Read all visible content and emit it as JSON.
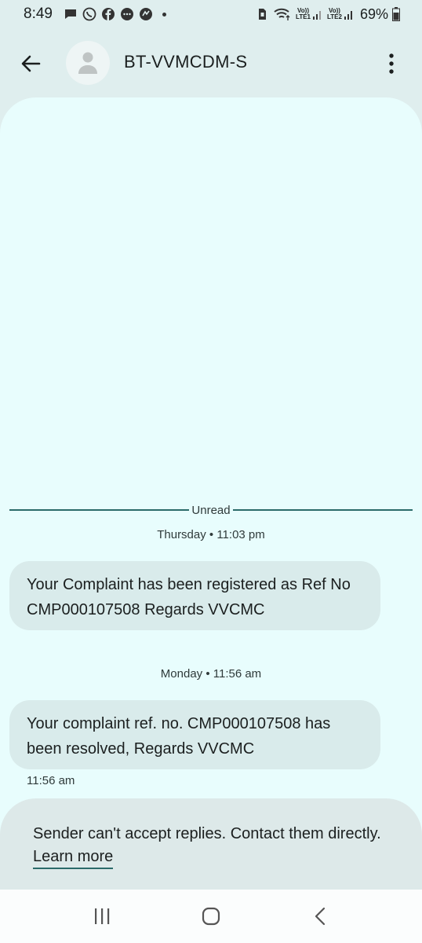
{
  "status_bar": {
    "time": "8:49",
    "battery": "69%",
    "sim1": "LTE1",
    "sim2": "LTE2",
    "volte": "Vo))"
  },
  "header": {
    "contact_name": "BT-VVMCDM-S",
    "back_icon": "arrow-back-icon",
    "more_icon": "more-vert-icon"
  },
  "conversation": {
    "unread_label": "Unread",
    "messages": [
      {
        "date": "Thursday • 11:03 pm",
        "text": "Your Complaint has been registered as Ref No CMP000107508 Regards VVCMC"
      },
      {
        "date": "Monday • 11:56 am",
        "text": "Your complaint ref. no. CMP000107508 has been resolved, Regards VVCMC",
        "time": "11:56 am"
      }
    ]
  },
  "reply_banner": {
    "text": "Sender can't accept replies. Contact them directly.",
    "link": "Learn more"
  },
  "colors": {
    "background": "#dfeeee",
    "conversation_bg": "#e8fdfd",
    "bubble": "#d9ebeb",
    "accent": "#2b6b6a"
  }
}
